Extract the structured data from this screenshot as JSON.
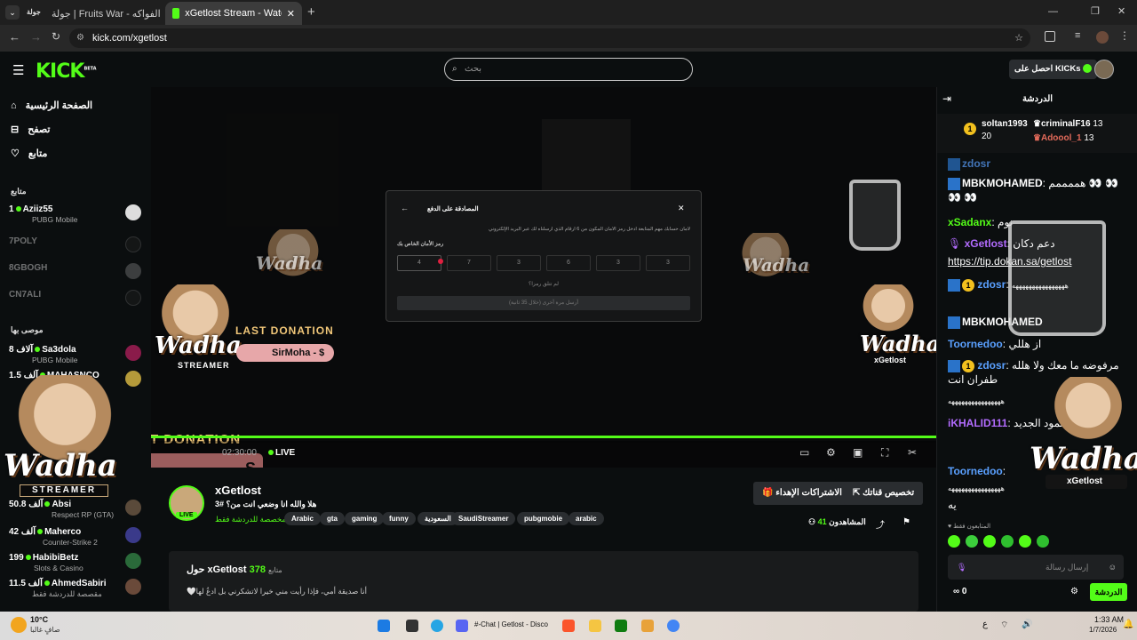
{
  "browser": {
    "tab1": "جولة | Fruits War - حرب الفواكه",
    "tab2": "xGetlost Stream - Watch Live on",
    "tab_new": "+",
    "url": "kick.com/xgetlost"
  },
  "topnav": {
    "logo": "KICK",
    "logo_badge": "BETA",
    "search_placeholder": "بحث",
    "get_kicks": "احصل على KICKs"
  },
  "sidebar": {
    "nav": [
      "الصفحة الرئيسية",
      "تصفح",
      "متابع"
    ],
    "following_title": "متابع",
    "following": [
      {
        "count": "1",
        "name": "Aziiz55",
        "game": "PUBG Mobile",
        "live": true
      },
      {
        "count": "",
        "name": "7POLY",
        "game": "",
        "live": false
      },
      {
        "count": "",
        "name": "8GBOGH",
        "game": "",
        "live": false
      },
      {
        "count": "",
        "name": "CN7ALI",
        "game": "",
        "live": false
      }
    ],
    "recommended_title": "موصى بها",
    "recommended": [
      {
        "count": "8 آلاف",
        "name": "Sa3dola",
        "game": "PUBG Mobile"
      },
      {
        "count": "1.5 آلف",
        "name": "MAHASNCO",
        "game": ""
      },
      {
        "count": "50.8 آلف",
        "name": "Absi",
        "game": "Respect RP (GTA)"
      },
      {
        "count": "42 آلف",
        "name": "Maherco",
        "game": "Counter-Strike 2"
      },
      {
        "count": "199",
        "name": "HabibiBetz",
        "game": "Slots & Casino"
      },
      {
        "count": "11.5 آلف",
        "name": "AhmedSabiri",
        "game": "مقصصة للدردشة فقط"
      }
    ]
  },
  "modal": {
    "title": "المصادقة على الدفع",
    "desc": "لأمان حسابك مهم المتابعة أدخل رمز الأمان المكون من 6 أرقام الذي أرسلناه لك عبر البريد الإلكتروني",
    "code_label": "رمز الأمان الخاص بك",
    "digits": [
      "4",
      "7",
      "3",
      "6",
      "3",
      "3"
    ],
    "resend_question": "لم تتلق رمزا؟",
    "resend": "أرسل مرة أخرى (خلال 35 ثانية)"
  },
  "overlay": {
    "last_donation": "LAST DONATION",
    "donor": "SirMoha - $",
    "wadha": "Wadha",
    "streamer": "STREAMER",
    "handle": "xGetlost",
    "bottom_amount": "S"
  },
  "player": {
    "live": "LIVE",
    "time": "02:30:00"
  },
  "stream": {
    "name": "xGetlost",
    "title": "هلا والله انا وضعي انت من؟ #3",
    "category": "مخصصة للدردشة فقط",
    "tags": [
      "Arabic",
      "gta",
      "gaming",
      "funny",
      "السعودية",
      "SaudiStreamer",
      "pubgmobie",
      "arabic"
    ],
    "sub_button": "الاشتراكات الإهداء",
    "custom_button": "تخصيص قناتك",
    "viewers_label": "المشاهدون",
    "viewers": "41",
    "live_badge": "LIVE"
  },
  "about": {
    "followers": "378",
    "followers_label": "متابع",
    "title": "حول xGetlost",
    "bio": "أنا صديقة أمي، فإذا رأيت مني خيرا لاتشكرني بل ادعُ لها🤍"
  },
  "chat": {
    "title": "الدردشة",
    "leaders": [
      {
        "rank": "1",
        "name": "soltan1993",
        "value": "20"
      },
      {
        "rank": "",
        "name": "criminalF16",
        "value": "13"
      },
      {
        "rank": "",
        "name": "Adoool_1",
        "value": "13"
      }
    ],
    "messages": [
      {
        "user": "zdosr",
        "text": ""
      },
      {
        "user": "MBKMOHAMED",
        "text": "هممممم 👀 👀 👀 👀"
      },
      {
        "user": "xSadanx",
        "text": "نوم"
      },
      {
        "user": "xGetlost",
        "text": "دعم دكان"
      },
      {
        "user": "",
        "text": "https://tip.dokan.sa/getlost"
      },
      {
        "user": "zdosr",
        "text": "ههههههههههههههههه"
      },
      {
        "user": "MBKMOHAMED",
        "text": ""
      },
      {
        "user": "Toornedoo",
        "text": "از هللي"
      },
      {
        "user": "zdosr",
        "text": "مرفوضه ما معك ولا هلله طفران انت"
      },
      {
        "user": "",
        "text": "ههههههههههههههههه"
      },
      {
        "user": "iKHALID111",
        "text": "تجربين المود الجديد"
      },
      {
        "user": "Toornedoo",
        "text": "ههههههههههههههههه"
      },
      {
        "user": "",
        "text": "يه"
      }
    ],
    "emote_hint": "المتابعون فقط",
    "input_placeholder": "إرسال رسالة",
    "send": "الدردشة",
    "kicks": "0"
  },
  "taskbar": {
    "temp": "10°C",
    "weather": "صافٍ غالبا",
    "active": "#-Chat | Getlost - Disco",
    "time": "1:33 AM",
    "date": "1/7/2026",
    "lang": "ع"
  },
  "colors": {
    "accent": "#53fc18",
    "background": "#0b0e0f",
    "panel": "#151617"
  }
}
